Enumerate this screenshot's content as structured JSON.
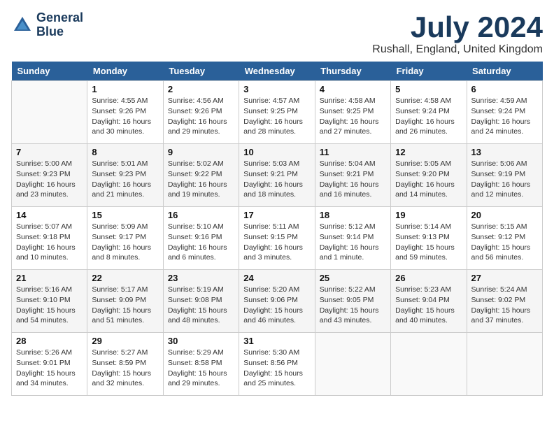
{
  "logo": {
    "line1": "General",
    "line2": "Blue"
  },
  "title": "July 2024",
  "location": "Rushall, England, United Kingdom",
  "days_of_week": [
    "Sunday",
    "Monday",
    "Tuesday",
    "Wednesday",
    "Thursday",
    "Friday",
    "Saturday"
  ],
  "weeks": [
    [
      {
        "day": "",
        "info": ""
      },
      {
        "day": "1",
        "info": "Sunrise: 4:55 AM\nSunset: 9:26 PM\nDaylight: 16 hours\nand 30 minutes."
      },
      {
        "day": "2",
        "info": "Sunrise: 4:56 AM\nSunset: 9:26 PM\nDaylight: 16 hours\nand 29 minutes."
      },
      {
        "day": "3",
        "info": "Sunrise: 4:57 AM\nSunset: 9:25 PM\nDaylight: 16 hours\nand 28 minutes."
      },
      {
        "day": "4",
        "info": "Sunrise: 4:58 AM\nSunset: 9:25 PM\nDaylight: 16 hours\nand 27 minutes."
      },
      {
        "day": "5",
        "info": "Sunrise: 4:58 AM\nSunset: 9:24 PM\nDaylight: 16 hours\nand 26 minutes."
      },
      {
        "day": "6",
        "info": "Sunrise: 4:59 AM\nSunset: 9:24 PM\nDaylight: 16 hours\nand 24 minutes."
      }
    ],
    [
      {
        "day": "7",
        "info": "Sunrise: 5:00 AM\nSunset: 9:23 PM\nDaylight: 16 hours\nand 23 minutes."
      },
      {
        "day": "8",
        "info": "Sunrise: 5:01 AM\nSunset: 9:23 PM\nDaylight: 16 hours\nand 21 minutes."
      },
      {
        "day": "9",
        "info": "Sunrise: 5:02 AM\nSunset: 9:22 PM\nDaylight: 16 hours\nand 19 minutes."
      },
      {
        "day": "10",
        "info": "Sunrise: 5:03 AM\nSunset: 9:21 PM\nDaylight: 16 hours\nand 18 minutes."
      },
      {
        "day": "11",
        "info": "Sunrise: 5:04 AM\nSunset: 9:21 PM\nDaylight: 16 hours\nand 16 minutes."
      },
      {
        "day": "12",
        "info": "Sunrise: 5:05 AM\nSunset: 9:20 PM\nDaylight: 16 hours\nand 14 minutes."
      },
      {
        "day": "13",
        "info": "Sunrise: 5:06 AM\nSunset: 9:19 PM\nDaylight: 16 hours\nand 12 minutes."
      }
    ],
    [
      {
        "day": "14",
        "info": "Sunrise: 5:07 AM\nSunset: 9:18 PM\nDaylight: 16 hours\nand 10 minutes."
      },
      {
        "day": "15",
        "info": "Sunrise: 5:09 AM\nSunset: 9:17 PM\nDaylight: 16 hours\nand 8 minutes."
      },
      {
        "day": "16",
        "info": "Sunrise: 5:10 AM\nSunset: 9:16 PM\nDaylight: 16 hours\nand 6 minutes."
      },
      {
        "day": "17",
        "info": "Sunrise: 5:11 AM\nSunset: 9:15 PM\nDaylight: 16 hours\nand 3 minutes."
      },
      {
        "day": "18",
        "info": "Sunrise: 5:12 AM\nSunset: 9:14 PM\nDaylight: 16 hours\nand 1 minute."
      },
      {
        "day": "19",
        "info": "Sunrise: 5:14 AM\nSunset: 9:13 PM\nDaylight: 15 hours\nand 59 minutes."
      },
      {
        "day": "20",
        "info": "Sunrise: 5:15 AM\nSunset: 9:12 PM\nDaylight: 15 hours\nand 56 minutes."
      }
    ],
    [
      {
        "day": "21",
        "info": "Sunrise: 5:16 AM\nSunset: 9:10 PM\nDaylight: 15 hours\nand 54 minutes."
      },
      {
        "day": "22",
        "info": "Sunrise: 5:17 AM\nSunset: 9:09 PM\nDaylight: 15 hours\nand 51 minutes."
      },
      {
        "day": "23",
        "info": "Sunrise: 5:19 AM\nSunset: 9:08 PM\nDaylight: 15 hours\nand 48 minutes."
      },
      {
        "day": "24",
        "info": "Sunrise: 5:20 AM\nSunset: 9:06 PM\nDaylight: 15 hours\nand 46 minutes."
      },
      {
        "day": "25",
        "info": "Sunrise: 5:22 AM\nSunset: 9:05 PM\nDaylight: 15 hours\nand 43 minutes."
      },
      {
        "day": "26",
        "info": "Sunrise: 5:23 AM\nSunset: 9:04 PM\nDaylight: 15 hours\nand 40 minutes."
      },
      {
        "day": "27",
        "info": "Sunrise: 5:24 AM\nSunset: 9:02 PM\nDaylight: 15 hours\nand 37 minutes."
      }
    ],
    [
      {
        "day": "28",
        "info": "Sunrise: 5:26 AM\nSunset: 9:01 PM\nDaylight: 15 hours\nand 34 minutes."
      },
      {
        "day": "29",
        "info": "Sunrise: 5:27 AM\nSunset: 8:59 PM\nDaylight: 15 hours\nand 32 minutes."
      },
      {
        "day": "30",
        "info": "Sunrise: 5:29 AM\nSunset: 8:58 PM\nDaylight: 15 hours\nand 29 minutes."
      },
      {
        "day": "31",
        "info": "Sunrise: 5:30 AM\nSunset: 8:56 PM\nDaylight: 15 hours\nand 25 minutes."
      },
      {
        "day": "",
        "info": ""
      },
      {
        "day": "",
        "info": ""
      },
      {
        "day": "",
        "info": ""
      }
    ]
  ]
}
